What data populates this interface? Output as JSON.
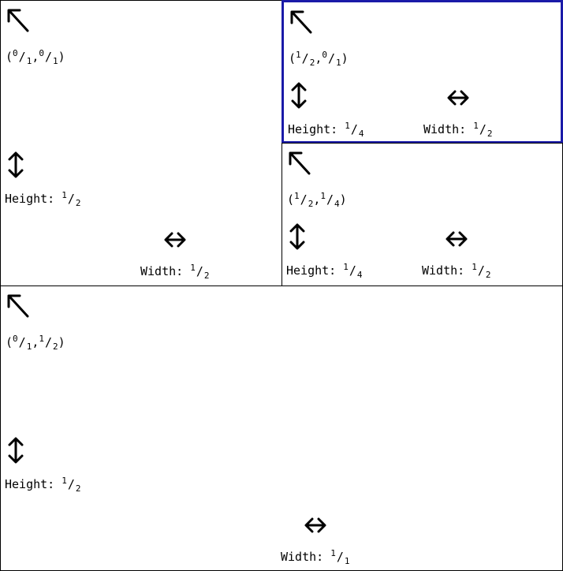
{
  "labels": {
    "height_prefix": "Height: ",
    "width_prefix": "Width: "
  },
  "icons": {
    "position": "north-west-arrow-icon",
    "height": "vertical-resize-icon",
    "width": "horizontal-resize-icon"
  },
  "colors": {
    "border": "#000000",
    "selected_border": "#1a1aa8"
  },
  "panes": [
    {
      "id": "pane-top-left",
      "selected": false,
      "origin": {
        "x_num": "0",
        "x_den": "1",
        "y_num": "0",
        "y_den": "1"
      },
      "height": {
        "num": "1",
        "den": "2"
      },
      "width": {
        "num": "1",
        "den": "2"
      }
    },
    {
      "id": "pane-top-right-upper",
      "selected": true,
      "origin": {
        "x_num": "1",
        "x_den": "2",
        "y_num": "0",
        "y_den": "1"
      },
      "height": {
        "num": "1",
        "den": "4"
      },
      "width": {
        "num": "1",
        "den": "2"
      }
    },
    {
      "id": "pane-top-right-lower",
      "selected": false,
      "origin": {
        "x_num": "1",
        "x_den": "2",
        "y_num": "1",
        "y_den": "4"
      },
      "height": {
        "num": "1",
        "den": "4"
      },
      "width": {
        "num": "1",
        "den": "2"
      }
    },
    {
      "id": "pane-bottom",
      "selected": false,
      "origin": {
        "x_num": "0",
        "x_den": "1",
        "y_num": "1",
        "y_den": "2"
      },
      "height": {
        "num": "1",
        "den": "2"
      },
      "width": {
        "num": "1",
        "den": "1"
      }
    }
  ]
}
